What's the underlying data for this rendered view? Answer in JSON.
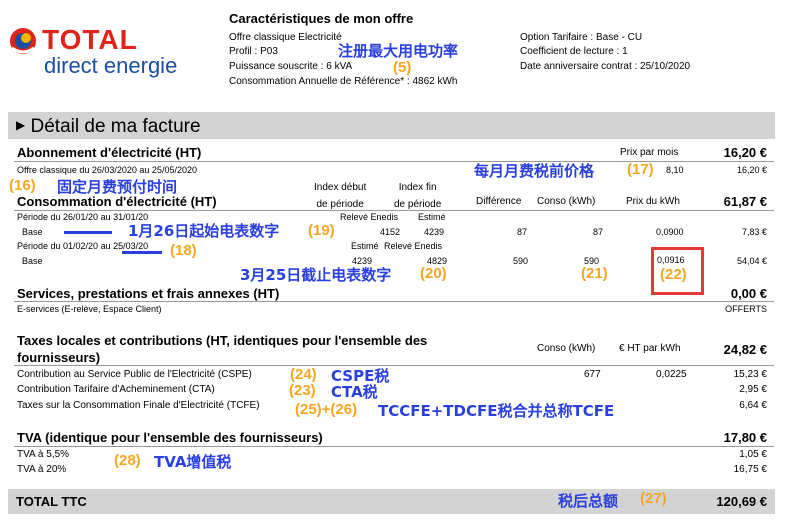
{
  "logo": {
    "brand": "TOTAL",
    "sub": "direct energie"
  },
  "offer": {
    "title": "Caractéristiques de mon offre",
    "lines": [
      "Offre classique Electricité",
      "Profil : P03",
      "Puissance souscrite : 6 kVA",
      "Consommation Annuelle de Référence* : 4862 kWh"
    ],
    "right_lines": [
      "Option Tarifaire : Base - CU",
      "Coefficient de lecture : 1",
      "Date anniversaire contrat : 25/10/2020"
    ]
  },
  "detail_title": "Détail de ma facture",
  "abonnement": {
    "title": "Abonnement d'électricité (HT)",
    "price_header": "Prix par mois",
    "total": "16,20 €",
    "line_label": "Offre classique du 26/03/2020 au 25/05/2020",
    "line_price": "8,10",
    "line_total": "16,20 €"
  },
  "conso": {
    "title": "Consommation d'électricité (HT)",
    "headers": {
      "index_debut": "Index début\nde période",
      "index_fin": "Index fin\nde période",
      "difference": "Différence",
      "conso": "Conso (kWh)",
      "prix": "Prix du kWh"
    },
    "total": "61,87 €",
    "period1": {
      "label": "Période du 26/01/20 au 31/01/20",
      "src_debut": "Relevé Enedis",
      "src_fin": "Estimé",
      "row_label": "Base",
      "debut": "4152",
      "fin": "4239",
      "difference": "87",
      "conso": "87",
      "prix": "0,0900",
      "total": "7,83 €"
    },
    "period2": {
      "label": "Période du 01/02/20 au 25/03/20",
      "src_debut": "Estimé",
      "src_fin": "Relevé Enedis",
      "row_label": "Base",
      "debut": "4239",
      "fin": "4829",
      "difference": "590",
      "conso": "590",
      "prix": "0,0916",
      "total": "54,04 €"
    }
  },
  "services": {
    "title": "Services, prestations et frais annexes (HT)",
    "total": "0,00 €",
    "line_label": "E-services (E-relève, Espace Client)",
    "line_value": "OFFERTS"
  },
  "taxes": {
    "title_line1": "Taxes locales et contributions (HT, identiques pour l'ensemble des",
    "title_line2": "fournisseurs)",
    "h_conso": "Conso (kWh)",
    "h_price": "€ HT par kWh",
    "total": "24,82 €",
    "rows": [
      {
        "label": "Contribution au Service Public de l'Electricité (CSPE)",
        "conso": "677",
        "price": "0,0225",
        "total": "15,23 €"
      },
      {
        "label": "Contribution Tarifaire d'Acheminement (CTA)",
        "total": "2,95 €"
      },
      {
        "label": "Taxes sur la Consommation Finale d'Electricité (TCFE)",
        "total": "6,64 €"
      }
    ]
  },
  "tva": {
    "title": "TVA (identique pour l'ensemble des fournisseurs)",
    "total": "17,80 €",
    "rows": [
      {
        "label": "TVA à 5,5%",
        "total": "1,05 €"
      },
      {
        "label": "TVA à 20%",
        "total": "16,75 €"
      }
    ]
  },
  "grand_total": {
    "label": "TOTAL TTC",
    "value": "120,69 €"
  },
  "annotations": {
    "power": "注册最大用电功率",
    "n5": "(5)",
    "monthly": "每月月费税前价格",
    "n17": "(17)",
    "n16": "(16)",
    "prepay": "固定月费预付时间",
    "start_index": "1月26日起始电表数字",
    "n19": "(19)",
    "n18": "(18)",
    "end_index": "3月25日截止电表数字",
    "n20": "(20)",
    "n21": "(21)",
    "n22": "(22)",
    "n24": "(24)",
    "cspe": "CSPE税",
    "n23": "(23)",
    "cta": "CTA税",
    "n25_26": "(25)+(26)",
    "tcfe": "TCCFE+TDCFE税合并总称TCFE",
    "n28": "(28)",
    "tva": "TVA增值税",
    "aftertax": "税后总额",
    "n27": "(27)"
  },
  "colors": {
    "brand_blue": "#1a4fa3",
    "brand_red": "#e2231a",
    "annot_blue": "#2a3fe0",
    "annot_orange": "#f5a623",
    "highlight_red": "#e53935",
    "bar_gray": "#d3d3d3"
  }
}
